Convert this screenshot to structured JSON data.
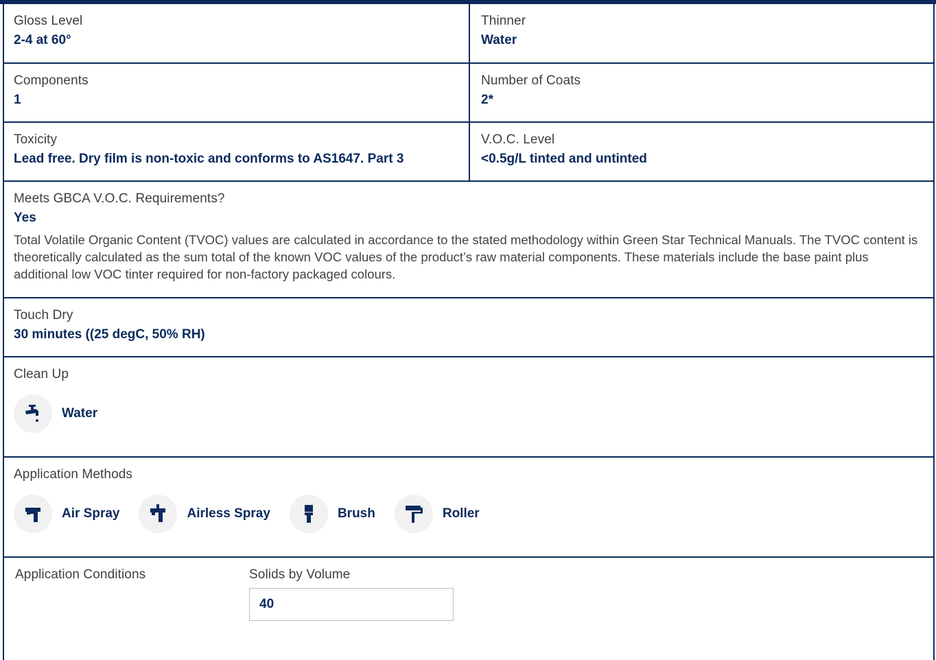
{
  "specs": {
    "gloss": {
      "label": "Gloss Level",
      "value": "2-4 at 60°"
    },
    "thinner": {
      "label": "Thinner",
      "value": "Water"
    },
    "components": {
      "label": "Components",
      "value": "1"
    },
    "coats": {
      "label": "Number of Coats",
      "value": "2*"
    },
    "toxicity": {
      "label": "Toxicity",
      "value": "Lead free. Dry film is non-toxic and conforms to AS1647. Part 3"
    },
    "voc": {
      "label": "V.O.C. Level",
      "value": "<0.5g/L tinted and untinted"
    },
    "gbca": {
      "label": "Meets GBCA V.O.C. Requirements?",
      "value": "Yes",
      "description": "Total Volatile Organic Content (TVOC) values are calculated in accordance to the stated methodology within Green Star Technical Manuals. The TVOC content is theoretically calculated as the sum total of the known VOC values of the product’s raw material components. These materials include the base paint plus additional low VOC tinter required for non-factory packaged colours."
    },
    "touch_dry": {
      "label": "Touch Dry",
      "value": "30 minutes ((25 degC, 50% RH)"
    }
  },
  "clean_up": {
    "label": "Clean Up",
    "items": [
      {
        "label": "Water",
        "icon": "tap-icon"
      }
    ]
  },
  "application_methods": {
    "label": "Application Methods",
    "items": [
      {
        "label": "Air Spray",
        "icon": "air-spray-gun-icon"
      },
      {
        "label": "Airless Spray",
        "icon": "airless-spray-gun-icon"
      },
      {
        "label": "Brush",
        "icon": "brush-icon"
      },
      {
        "label": "Roller",
        "icon": "roller-icon"
      }
    ]
  },
  "application_conditions": {
    "label": "Application Conditions"
  },
  "solids": {
    "label": "Solids by Volume",
    "value": "40"
  },
  "colors": {
    "accent": "#0a2a5e",
    "icon_bg": "#f1f1f1"
  }
}
